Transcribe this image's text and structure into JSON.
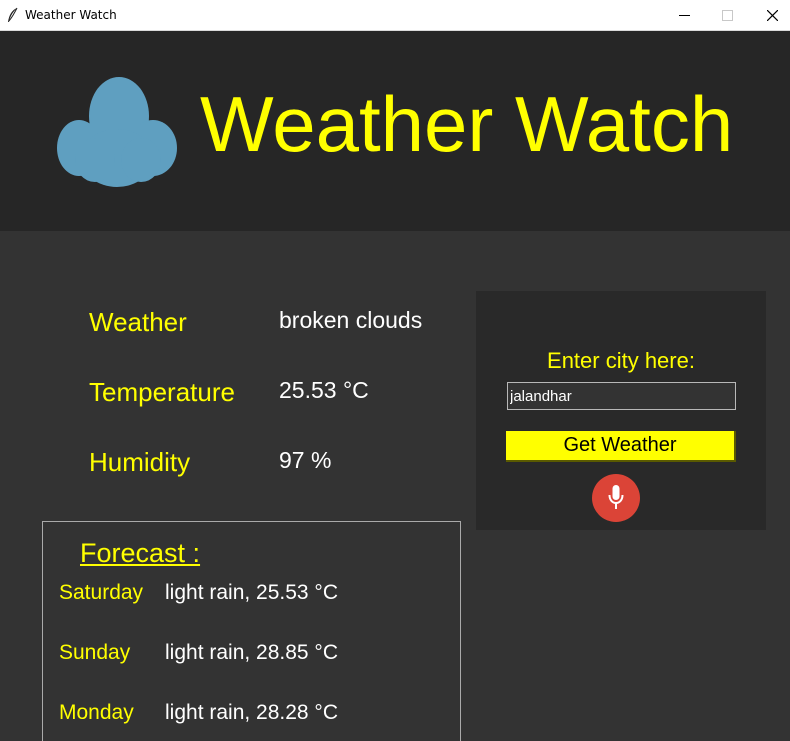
{
  "window": {
    "title": "Weather Watch",
    "controls": [
      "minimize",
      "maximize",
      "close"
    ]
  },
  "header": {
    "title": "Weather Watch",
    "icon": "cloud-icon"
  },
  "current": {
    "weather_label": "Weather",
    "weather_value": "broken clouds",
    "temperature_label": "Temperature",
    "temperature_value": "25.53 °C",
    "humidity_label": "Humidity",
    "humidity_value": "97 %"
  },
  "search": {
    "label": "Enter city here:",
    "city_value": "jalandhar",
    "button_label": "Get Weather",
    "voice_icon": "microphone-icon"
  },
  "forecast": {
    "title": "Forecast :",
    "days": [
      {
        "day": "Saturday",
        "value": "light rain, 25.53 °C"
      },
      {
        "day": "Sunday",
        "value": "light rain, 28.85 °C"
      },
      {
        "day": "Monday",
        "value": "light rain, 28.28 °C"
      }
    ]
  },
  "colors": {
    "accent": "#ffff00",
    "background": "#333333",
    "header_background": "#262626",
    "panel_background": "#292929",
    "cloud": "#5f9fc0",
    "mic_button": "#db4437"
  }
}
